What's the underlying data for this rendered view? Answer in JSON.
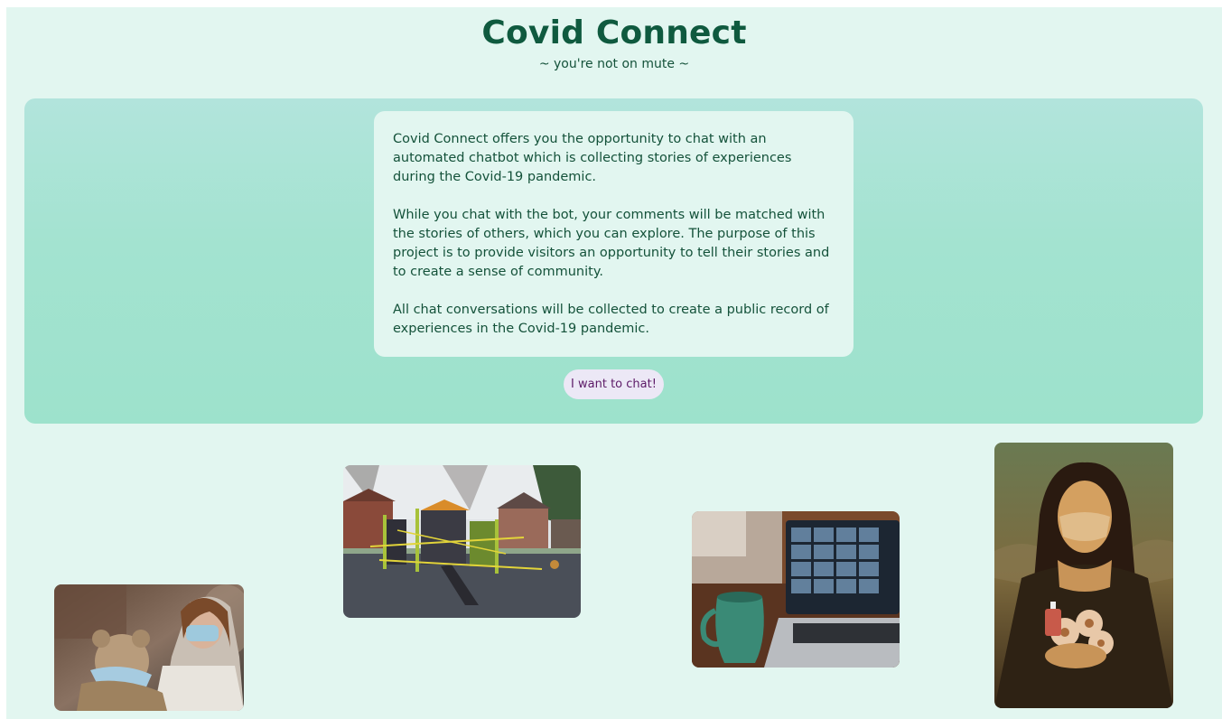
{
  "header": {
    "title": "Covid Connect",
    "tagline": "~ you're not on mute ~"
  },
  "intro": {
    "paragraphs": [
      "Covid Connect offers you the opportunity to chat with an automated chatbot which is collecting stories of experiences during the Covid-19 pandemic.",
      "While you chat with the bot, your comments will be matched with the stories of others, which you can explore. The purpose of this project is to provide visitors an opportunity to tell their stories and to create a sense of community.",
      "All chat conversations will be collected to create a public record of experiences in the Covid-19 pandemic."
    ],
    "cta_label": "I want to chat!"
  },
  "colors": {
    "background": "#e2f6f0",
    "hero_top": "#b2e4dc",
    "hero_bottom": "#9de2cc",
    "title": "#0f5a3f",
    "button_bg": "#ece8f6",
    "button_text": "#5c1a67"
  },
  "gallery": [
    {
      "name": "masked-teddy-bear-photo"
    },
    {
      "name": "taped-playground-photo"
    },
    {
      "name": "video-call-laptop-photo"
    },
    {
      "name": "masked-mona-lisa-photo"
    }
  ]
}
